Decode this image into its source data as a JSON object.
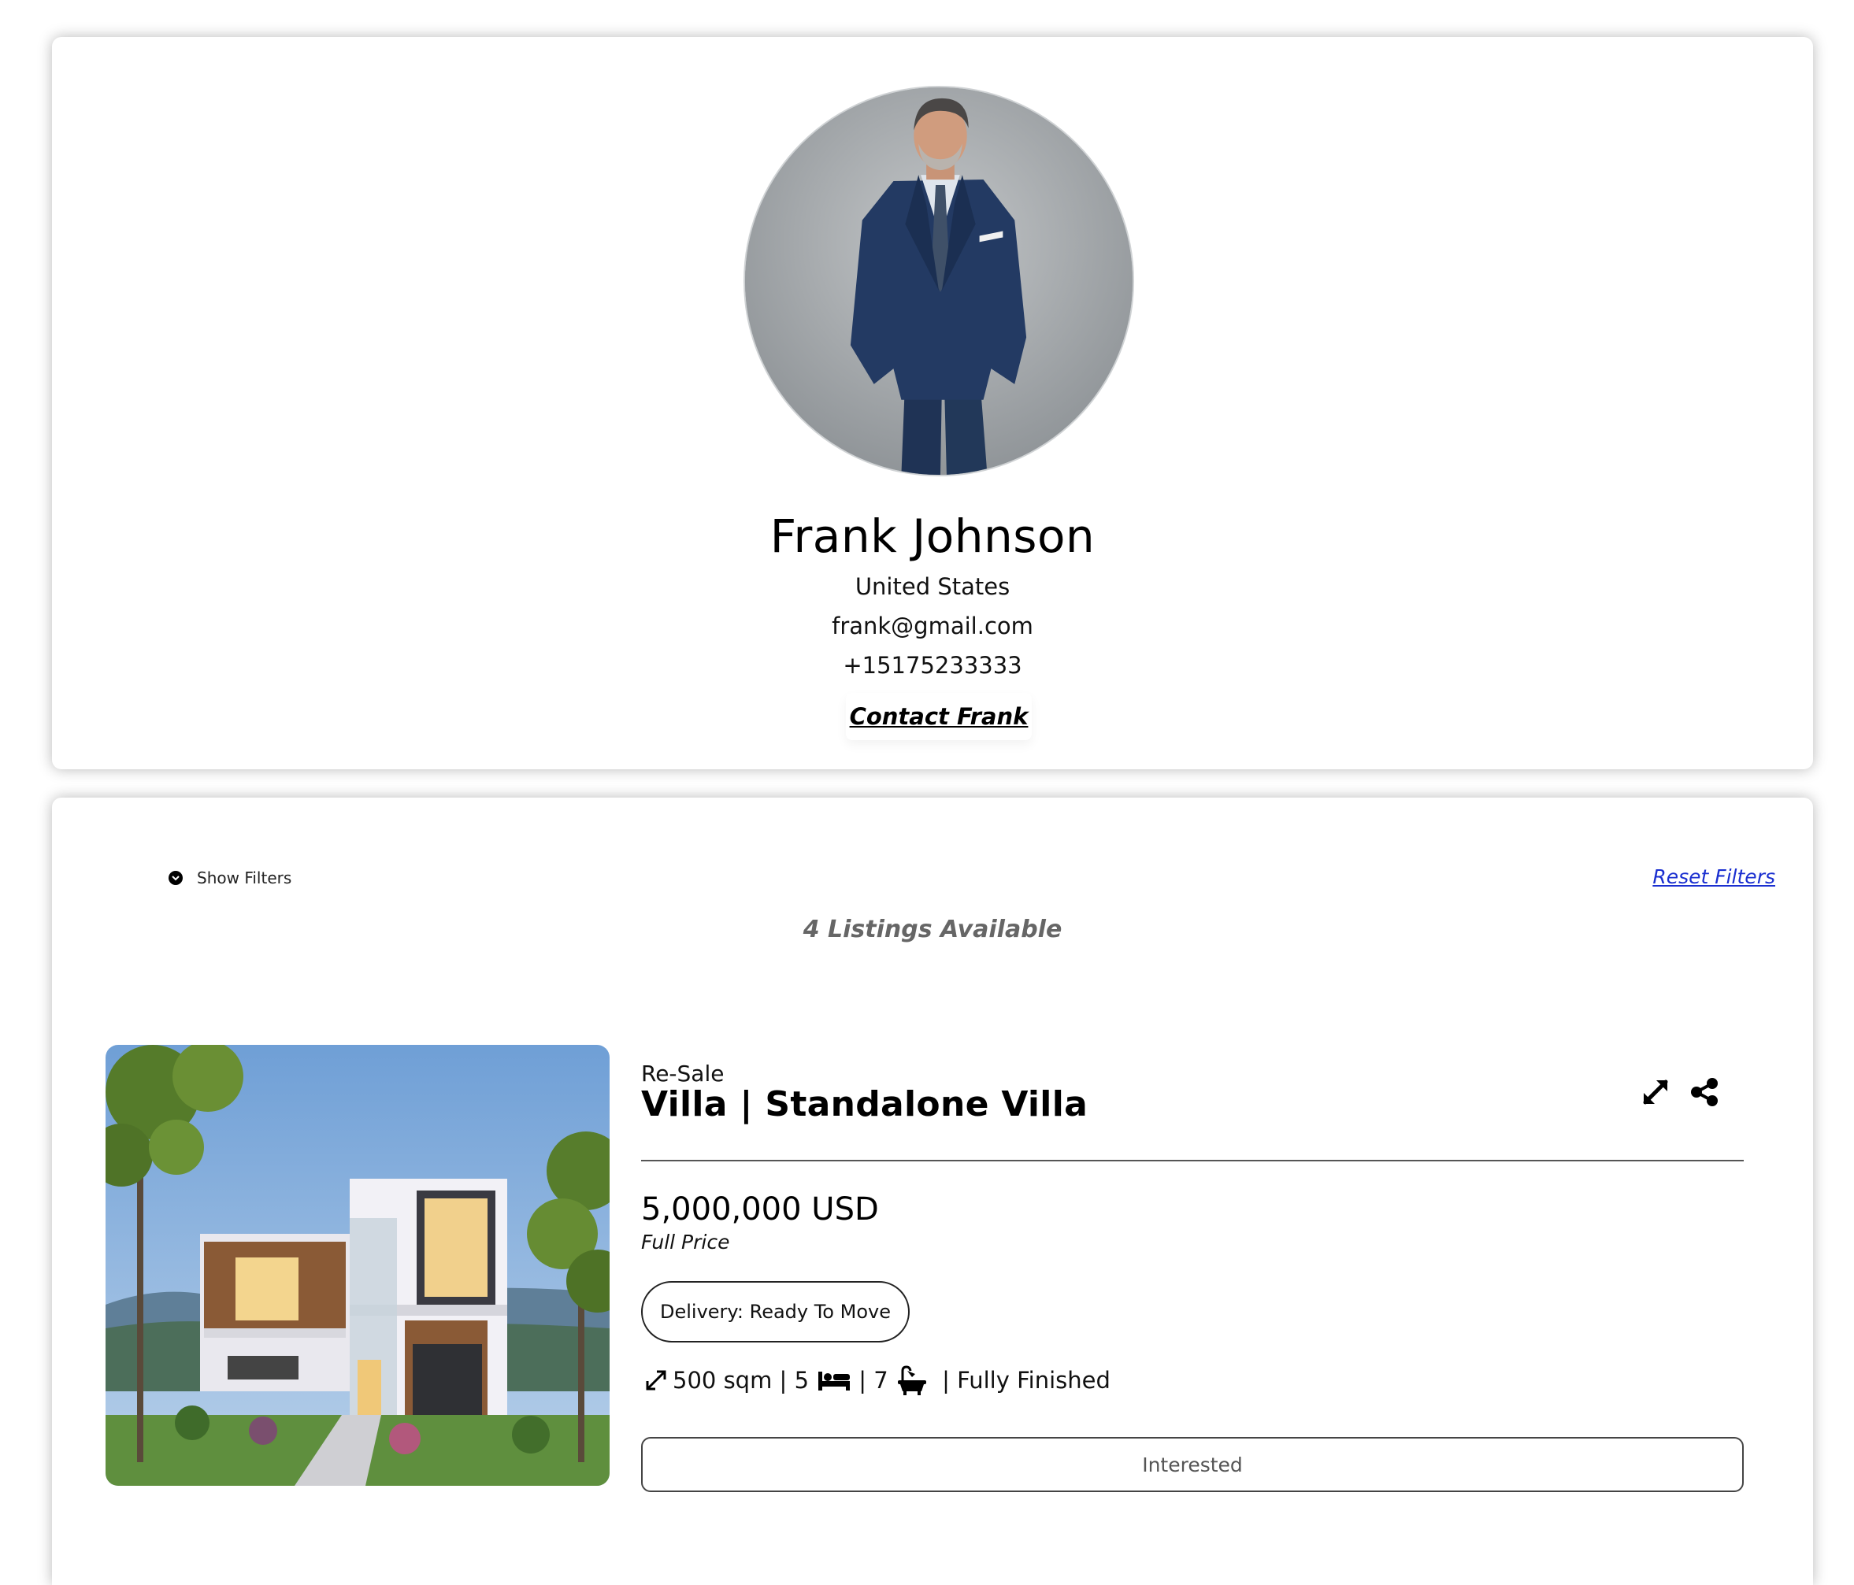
{
  "profile": {
    "name": "Frank Johnson",
    "country": "United States",
    "email": "frank@gmail.com",
    "phone": "+15175233333",
    "contact_label": "Contact Frank"
  },
  "filters": {
    "show_label": "Show Filters",
    "reset_label": "Reset Filters"
  },
  "listings_summary": {
    "count_label": "4 Listings Available"
  },
  "listing": {
    "sale_type": "Re-Sale",
    "title": "Villa | Standalone Villa",
    "price": "5,000,000 USD",
    "price_type": "Full Price",
    "delivery": "Delivery: Ready To Move",
    "area": "500 sqm",
    "sep1": " | ",
    "bedrooms": "5",
    "sep2": " | ",
    "bathrooms": "7",
    "sep3": "  | ",
    "finishing": "Fully Finished",
    "interested_label": "Interested"
  },
  "icons": {
    "expand": "expand-icon",
    "share": "share-icon",
    "area": "resize-arrow-icon",
    "bed": "bed-icon",
    "bath": "bathtub-icon",
    "chevron": "chevron-down-circle-icon"
  },
  "colors": {
    "link_blue": "#1a2fd0",
    "muted_text": "#666666",
    "border": "#444444"
  }
}
